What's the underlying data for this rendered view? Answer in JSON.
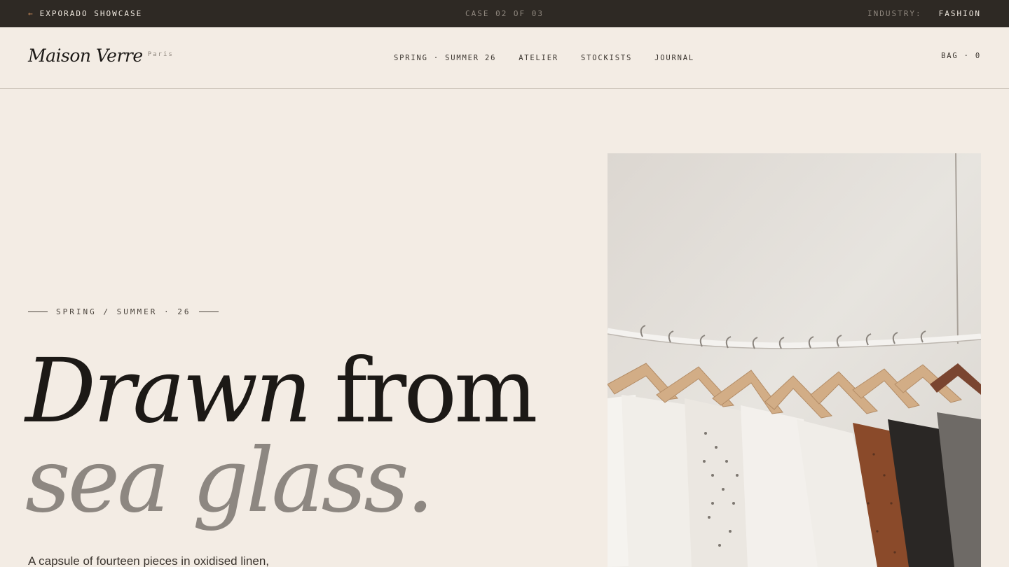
{
  "topbar": {
    "back_label": "EXPORADO SHOWCASE",
    "back_icon": "arrow-left-icon",
    "case_label": "CASE 02 OF 03",
    "industry_key": "INDUSTRY:",
    "industry_value": "FASHION"
  },
  "header": {
    "brand": "Maison Verre",
    "city": "Paris",
    "nav": [
      "SPRING · SUMMER 26",
      "ATELIER",
      "STOCKISTS",
      "JOURNAL"
    ],
    "bag": "BAG · 0"
  },
  "hero": {
    "eyebrow": "SPRING / SUMMER · 26",
    "headline_italic": "Drawn",
    "headline_rest": " from",
    "headline_line2": "sea glass.",
    "lead": "A capsule of fourteen pieces in oxidised linen,",
    "image_alt": "clothing-rack-photo"
  },
  "colors": {
    "background": "#f3ece4",
    "topbar": "#2e2924",
    "accent": "#c98a5a",
    "ink": "#1c1916",
    "muted_headline": "#8d8781"
  }
}
